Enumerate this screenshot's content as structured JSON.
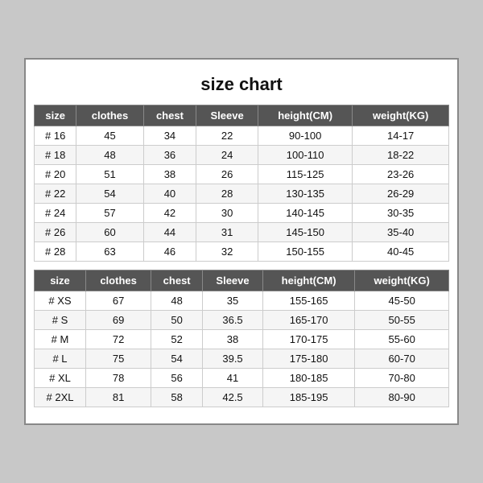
{
  "title": "size chart",
  "table1": {
    "headers": [
      "size",
      "clothes",
      "chest",
      "Sleeve",
      "height(CM)",
      "weight(KG)"
    ],
    "rows": [
      [
        "# 16",
        "45",
        "34",
        "22",
        "90-100",
        "14-17"
      ],
      [
        "# 18",
        "48",
        "36",
        "24",
        "100-110",
        "18-22"
      ],
      [
        "# 20",
        "51",
        "38",
        "26",
        "115-125",
        "23-26"
      ],
      [
        "# 22",
        "54",
        "40",
        "28",
        "130-135",
        "26-29"
      ],
      [
        "# 24",
        "57",
        "42",
        "30",
        "140-145",
        "30-35"
      ],
      [
        "# 26",
        "60",
        "44",
        "31",
        "145-150",
        "35-40"
      ],
      [
        "# 28",
        "63",
        "46",
        "32",
        "150-155",
        "40-45"
      ]
    ]
  },
  "table2": {
    "headers": [
      "size",
      "clothes",
      "chest",
      "Sleeve",
      "height(CM)",
      "weight(KG)"
    ],
    "rows": [
      [
        "# XS",
        "67",
        "48",
        "35",
        "155-165",
        "45-50"
      ],
      [
        "# S",
        "69",
        "50",
        "36.5",
        "165-170",
        "50-55"
      ],
      [
        "# M",
        "72",
        "52",
        "38",
        "170-175",
        "55-60"
      ],
      [
        "# L",
        "75",
        "54",
        "39.5",
        "175-180",
        "60-70"
      ],
      [
        "# XL",
        "78",
        "56",
        "41",
        "180-185",
        "70-80"
      ],
      [
        "# 2XL",
        "81",
        "58",
        "42.5",
        "185-195",
        "80-90"
      ]
    ]
  }
}
